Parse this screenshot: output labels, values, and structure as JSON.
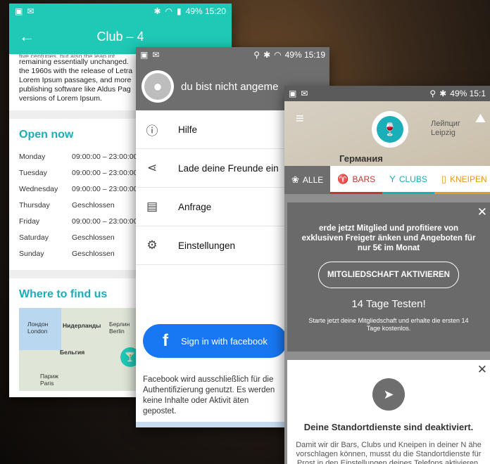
{
  "phone1": {
    "status": {
      "left_icons": [
        "image-icon",
        "mail-icon"
      ],
      "right": "49% 15:20"
    },
    "appbar": {
      "title": "Club – 4"
    },
    "lorem_lines": [
      "remaining essentially unchanged.",
      "the 1960s with the release of Letra",
      "Lorem Ipsum passages, and more",
      "publishing software like Aldus Pag",
      "versions of Lorem Ipsum."
    ],
    "lorem_cut": "five centuries, but also the leap int",
    "open_now": {
      "title": "Open now",
      "rows": [
        {
          "day": "Monday",
          "hours": "09:00:00 – 23:00:00"
        },
        {
          "day": "Tuesday",
          "hours": "09:00:00 – 23:00:00"
        },
        {
          "day": "Wednesday",
          "hours": "09:00:00 – 23:00:00"
        },
        {
          "day": "Thursday",
          "hours": "Geschlossen"
        },
        {
          "day": "Friday",
          "hours": "09:00:00 – 23:00:00"
        },
        {
          "day": "Saturday",
          "hours": "Geschlossen"
        },
        {
          "day": "Sunday",
          "hours": "Geschlossen"
        }
      ]
    },
    "where": {
      "title": "Where to find us",
      "map_labels": {
        "london": "Лондон\nLondon",
        "netherlands": "Нидерланды",
        "berlin": "Берлин\nBerlin",
        "belgium": "Бельгия",
        "paris": "Париж\nParis"
      }
    }
  },
  "phone2": {
    "status": {
      "right": "49% 15:19"
    },
    "header": {
      "name": "du bist nicht angeme"
    },
    "menu": [
      {
        "icon": "help-icon",
        "label": "Hilfe"
      },
      {
        "icon": "share-icon",
        "label": "Lade deine Freunde ein"
      },
      {
        "icon": "feedback-icon",
        "label": "Anfrage"
      },
      {
        "icon": "settings-icon",
        "label": "Einstellungen"
      }
    ],
    "facebook_button": "Sign in with facebook",
    "facebook_note": "Facebook wird ausschließlich für die Authentifizierung genutzt. Es werden keine Inhalte oder Aktivit äten gepostet."
  },
  "phone3": {
    "status": {
      "right": "49% 15:1"
    },
    "map": {
      "city": "Лейпциг\nLeipzig",
      "country": "Германия"
    },
    "tabs": [
      {
        "label": "ALLE",
        "icon": "all-icon",
        "kind": "active"
      },
      {
        "label": "BARS",
        "icon": "wine-glass-icon",
        "kind": "bars"
      },
      {
        "label": "CLUBS",
        "icon": "cocktail-icon",
        "kind": "clubs"
      },
      {
        "label": "KNEIPEN",
        "icon": "beer-icon",
        "kind": "kneipen"
      }
    ],
    "promo": {
      "text": "erde jetzt Mitglied und profitiere von exklusiven Freigetr änken und Angeboten für nur 5€ im Monat",
      "button": "MITGLIEDSCHAFT AKTIVIEREN",
      "trial": "14 Tage Testen!",
      "sub": "Starte jetzt deine Mitgliedschaft und erhalte die ersten 14 Tage kostenlos."
    },
    "location": {
      "head": "Deine Standortdienste sind deaktiviert.",
      "body": "Damit wir dir Bars, Clubs und Kneipen in deiner N ähe vorschlagen können, musst du die Standortdienste für Prost in den Einstellungen deines Telefons aktivieren."
    }
  }
}
